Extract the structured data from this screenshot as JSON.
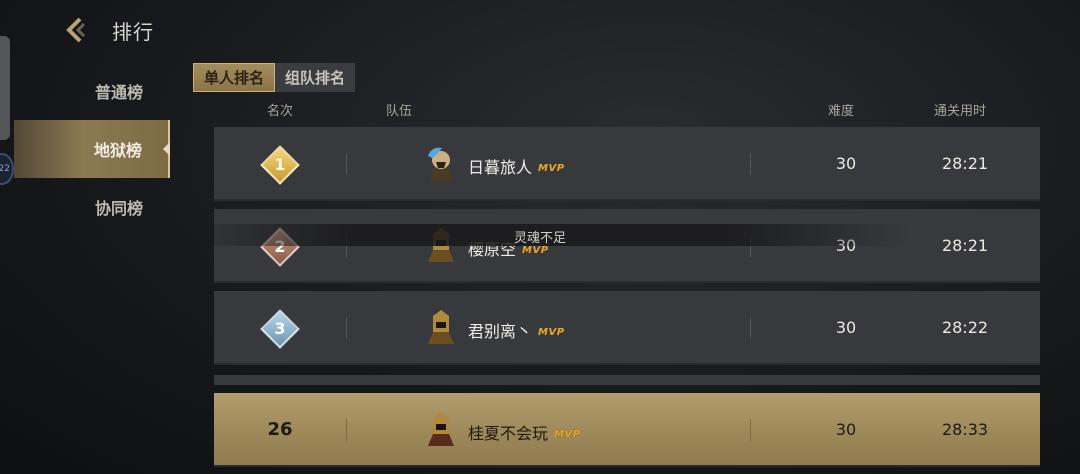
{
  "header": {
    "title": "排行"
  },
  "sidebar": {
    "items": [
      {
        "label": "普通榜",
        "active": false
      },
      {
        "label": "地狱榜",
        "active": true
      },
      {
        "label": "协同榜",
        "active": false
      }
    ]
  },
  "tabs": [
    {
      "label": "单人排名",
      "active": true
    },
    {
      "label": "组队排名",
      "active": false
    }
  ],
  "columns": {
    "rank": "名次",
    "team": "队伍",
    "difficulty": "难度",
    "time": "通关用时"
  },
  "rows": [
    {
      "rank": "1",
      "name": "日暮旅人",
      "badge": "MVP",
      "difficulty": "30",
      "time": "28:21"
    },
    {
      "rank": "2",
      "name": "樱原空",
      "badge": "MVP",
      "difficulty": "30",
      "time": "28:21"
    },
    {
      "rank": "3",
      "name": "君别离丶",
      "badge": "MVP",
      "difficulty": "30",
      "time": "28:22"
    }
  ],
  "self_row": {
    "rank": "26",
    "name": "桂夏不会玩",
    "badge": "MVP",
    "difficulty": "30",
    "time": "28:33"
  },
  "toast": {
    "text": "灵魂不足"
  },
  "edge_bubble": {
    "text": "22"
  },
  "colors": {
    "gold": "#c89a34",
    "highlight_row": "#9c8759",
    "row_bg": "#37393d"
  }
}
